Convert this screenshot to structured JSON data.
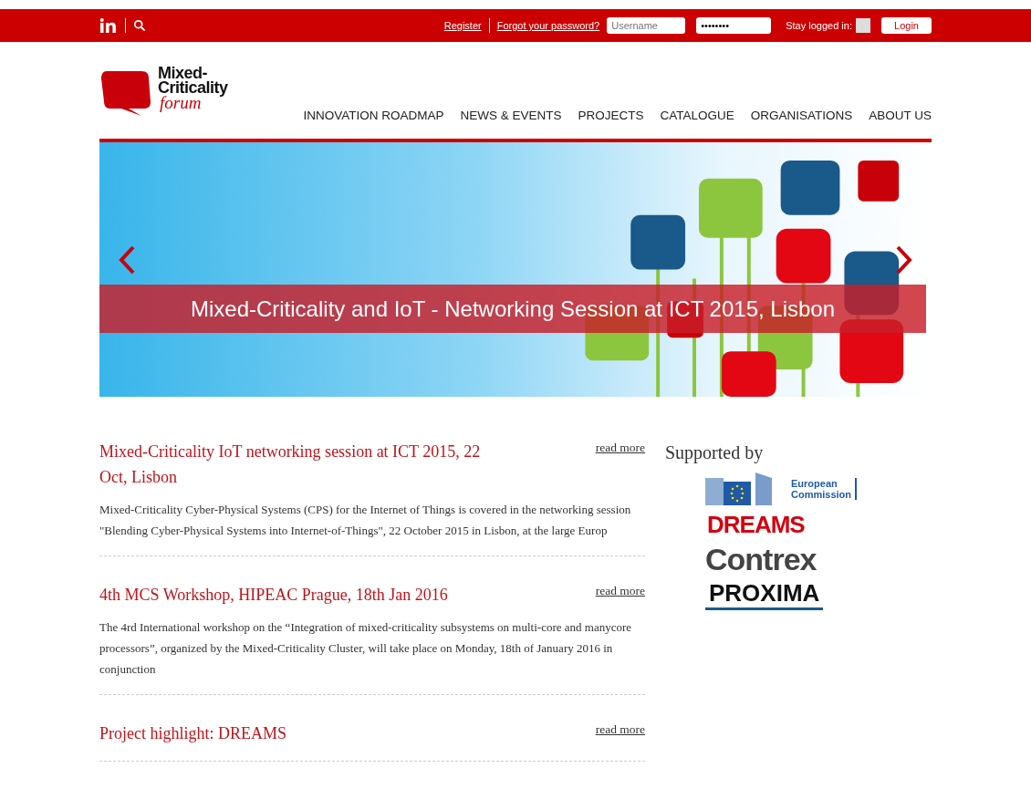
{
  "top_bar": {
    "links": [
      "Register",
      "Forgot your password?"
    ],
    "username": {
      "placeholder": "Username"
    },
    "password": {
      "value": "••••••••"
    },
    "stay_logged_in": {
      "label": "Stay logged in:",
      "checked": false
    },
    "login_button": "Login"
  },
  "logo": {
    "line1": "Mixed-",
    "line2": "Criticality",
    "line3": "forum"
  },
  "nav": [
    {
      "label": "INNOVATION ROADMAP"
    },
    {
      "label": "NEWS & EVENTS"
    },
    {
      "label": "PROJECTS"
    },
    {
      "label": "CATALOGUE"
    },
    {
      "label": "ORGANISATIONS"
    },
    {
      "label": "ABOUT US"
    }
  ],
  "slider": {
    "caption": "Mixed-Criticality and IoT - Networking Session at ICT 2015, Lisbon"
  },
  "news": [
    {
      "title": "Mixed-Criticality IoT networking session at ICT 2015, 22 Oct, Lisbon",
      "link": "read more",
      "text": "Mixed-Criticality Cyber-Physical Systems (CPS) for the Internet of Things is covered in the networking session \"Blending Cyber-Physical Systems into Internet-of-Things\", 22 October 2015 in Lisbon, at the large Europ"
    },
    {
      "title": "4th MCS Workshop, HIPEAC Prague, 18th Jan 2016",
      "link": "read more",
      "text": "The 4rd International workshop on the “Integration of mixed-criticality subsystems on multi-core and manycore processors”, organized by the Mixed-Criticality Cluster, will take place on Monday, 18th of January 2016 in conjunction"
    },
    {
      "title": "Project highlight: DREAMS",
      "link": "read more"
    }
  ],
  "sidebar": {
    "title": "Supported by",
    "sponsors": [
      {
        "kind": "ec",
        "line1": "European",
        "line2": "Commission"
      },
      {
        "kind": "dreams",
        "name": "DREAMS"
      },
      {
        "kind": "contrex",
        "name": "Contrex"
      },
      {
        "kind": "proxima",
        "name": "PROXIMA"
      }
    ]
  }
}
